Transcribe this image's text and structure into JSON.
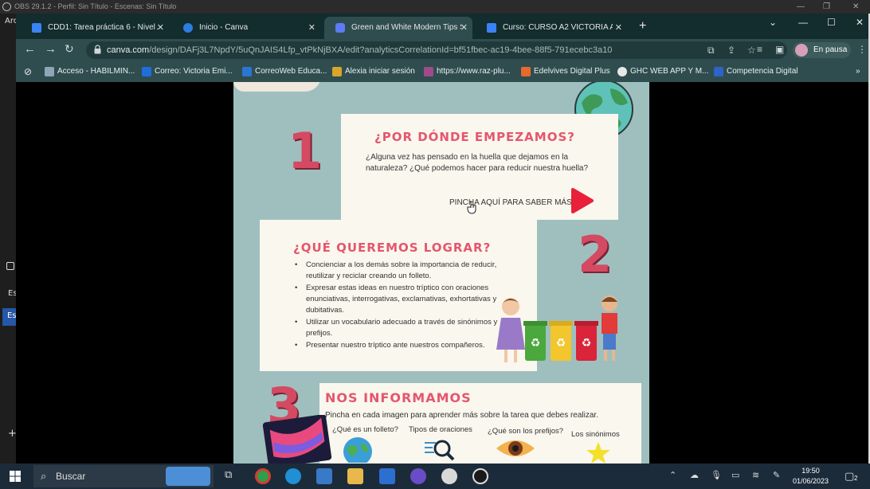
{
  "obs": {
    "title": "OBS 29.1.2 - Perfil: Sin Título - Escenas: Sin Título"
  },
  "left_strip": {
    "labels": [
      "Arc",
      "Es",
      "Es"
    ]
  },
  "browser": {
    "tabs": [
      {
        "label": "CDD1: Tarea práctica 6 - Nivel A2",
        "favicon_color": "#3b82f6"
      },
      {
        "label": "Inicio - Canva",
        "favicon_color": "#2b7de0"
      },
      {
        "label": "Green and White Modern Tips Sc",
        "favicon_color": "#5b7cf7"
      },
      {
        "label": "Curso: CURSO A2 VICTORIA AUG",
        "favicon_color": "#3b82f6"
      }
    ],
    "tab_close": "✕",
    "new_tab": "+",
    "url_host": "canva.com",
    "url_path": "/design/DAFj3L7NpdY/5uQnJAIS4Lfp_vtPkNjBXA/edit?analyticsCorrelationId=bf51fbec-ac19-4bee-88f5-791ecebc3a10",
    "profile_status": "En pausa",
    "bookmarks": [
      {
        "label": "Acceso - HABILMIN...",
        "color": "#8fa6b6"
      },
      {
        "label": "Correo: Victoria Emi...",
        "color": "#1e6fd9"
      },
      {
        "label": "CorreoWeb Educa...",
        "color": "#2a76d2"
      },
      {
        "label": "Alexia iniciar sesión",
        "color": "#d9a52a"
      },
      {
        "label": "https://www.raz-plu...",
        "color": "#a04a8a"
      },
      {
        "label": "Edelvives Digital Plus",
        "color": "#e56a2c"
      },
      {
        "label": "GHC WEB APP Y M...",
        "color": "#e8e8e8"
      },
      {
        "label": "Competencia Digital",
        "color": "#2e63c8"
      }
    ]
  },
  "design": {
    "section1": {
      "number": "1",
      "title": "¿POR DÓNDE EMPEZAMOS?",
      "text": "¿Alguna vez has pensado en la huella que dejamos en la naturaleza? ¿Qué podemos hacer para reducir nuestra huella?",
      "cta": "PINCHA AQUÍ PARA SABER MÁS"
    },
    "section2": {
      "number": "2",
      "title": "¿QUÉ QUEREMOS LOGRAR?",
      "bullets": [
        "Concienciar a los demás sobre la importancia de reducir, reutilizar y reciclar creando un folleto.",
        "Expresar estas ideas en nuestro tríptico con oraciones enunciativas, interrogativas, exclamativas, exhortativas y dubitativas.",
        "Utilizar un vocabulario adecuado a través de sinónimos y prefijos.",
        "Presentar nuestro tríptico ante nuestros compañeros."
      ]
    },
    "section3": {
      "number": "3",
      "title": "NOS INFORMAMOS",
      "subtitle": "Pincha en cada imagen para aprender más sobre la tarea que debes realizar.",
      "items": [
        "¿Qué es un folleto?",
        "Tipos de oraciones",
        "¿Qué son los prefijos?",
        "Los sinónimos"
      ]
    },
    "colors": {
      "accent": "#e5566d",
      "background": "#9fbfbf",
      "card": "#faf7ee"
    }
  },
  "taskbar": {
    "search_label": "Buscar",
    "time": "19:50",
    "date": "01/06/2023",
    "notifications": "2"
  }
}
